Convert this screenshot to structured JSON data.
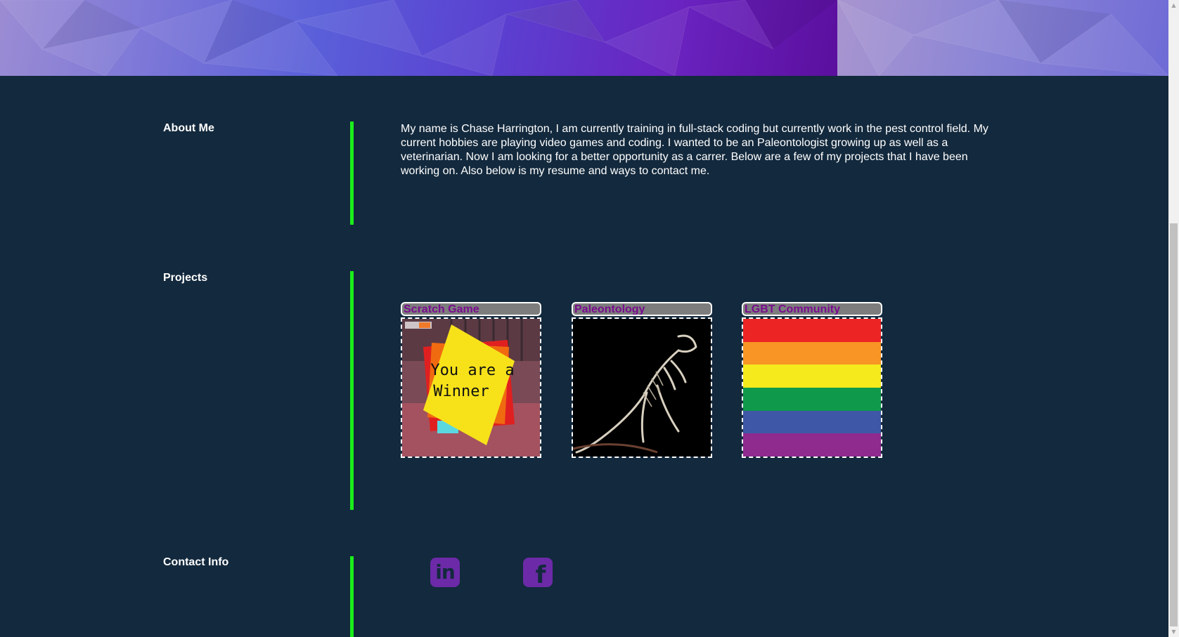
{
  "about": {
    "label": "About Me",
    "text": "My name is Chase Harrington, I am currently training in full-stack coding but currently work in the pest control field. My current hobbies are playing video games and coding. I wanted to be an Paleontologist growing up as well as a veterinarian. Now I am looking for a better opportunity as a carrer. Below are a few of my projects that I have been working on. Also below is my resume and ways to contact me."
  },
  "projects": {
    "label": "Projects",
    "items": [
      {
        "title": "Scratch Game",
        "image_icon": "winner-screen-image",
        "image_text_line1": "You are a",
        "image_text_line2": "Winner"
      },
      {
        "title": "Paleontology",
        "image_icon": "dinosaur-skeleton-image"
      },
      {
        "title": "LGBT Community",
        "image_icon": "rainbow-flag-image"
      }
    ]
  },
  "contact": {
    "label": "Contact Info",
    "links": [
      {
        "icon": "linkedin-icon",
        "glyph": "in"
      },
      {
        "icon": "facebook-icon",
        "glyph": "f"
      }
    ]
  },
  "scrollbar": {
    "up_glyph": "▲",
    "down_glyph": "▼"
  },
  "colors": {
    "background": "#13293d",
    "accent_bar": "#1bef1b",
    "card_title": "#7a0a8e",
    "social_icon": "#6c2aa8"
  }
}
